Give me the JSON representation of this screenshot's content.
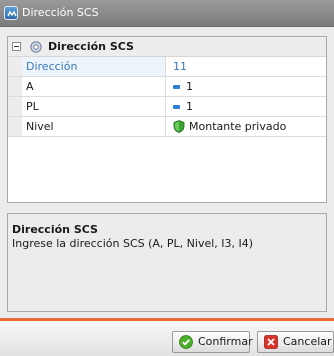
{
  "window": {
    "title": "Dirección SCS",
    "icon": "app-icon"
  },
  "grid": {
    "category": "Dirección SCS",
    "rows": [
      {
        "name": "Dirección",
        "value": "11",
        "icon": ""
      },
      {
        "name": "A",
        "value": "1",
        "icon": "flag-icon"
      },
      {
        "name": "PL",
        "value": "1",
        "icon": "flag-icon"
      },
      {
        "name": "Nivel",
        "value": "Montante privado",
        "icon": "shield-icon"
      }
    ]
  },
  "description": {
    "title": "Dirección SCS",
    "text": "Ingrese la dirección SCS (A, PL, Nivel, I3, I4)"
  },
  "footer": {
    "confirm_label": "Confirmar",
    "cancel_label": "Cancelar"
  },
  "colors": {
    "accent": "#e86b36",
    "selected_text": "#3b78b8",
    "confirm_icon": "#4caf2a",
    "cancel_icon": "#d9322a"
  }
}
